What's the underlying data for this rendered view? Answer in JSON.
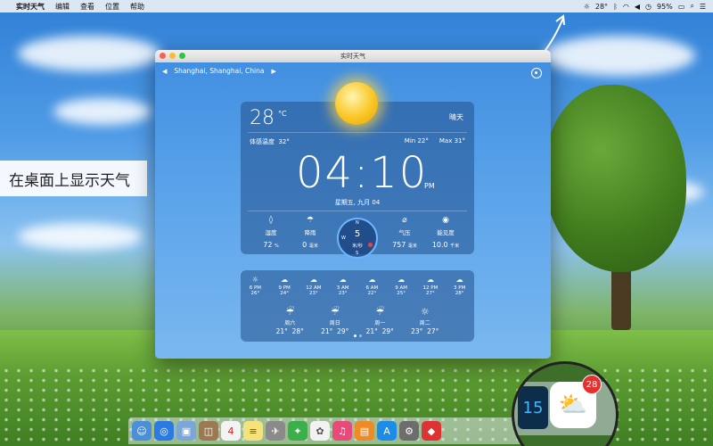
{
  "menubar": {
    "apple_icon": "apple-icon",
    "items": [
      "实时天气",
      "编辑",
      "查看",
      "位置",
      "帮助"
    ],
    "status": {
      "weather": "28°",
      "battery": "95%"
    }
  },
  "side_label": "在桌面上显示天气",
  "window": {
    "title": "实时天气",
    "location": "Shanghai, Shanghai, China",
    "current": {
      "temp": "28",
      "unit": "°C",
      "condition": "晴天",
      "feels_like_label": "体感温度",
      "feels_like": "32°",
      "min_label": "Min",
      "min": "22°",
      "max_label": "Max",
      "max": "31°",
      "time": "04:10",
      "ampm": "PM",
      "date": "星期五, 九月 04"
    },
    "stats": {
      "humidity": {
        "label": "湿度",
        "value": "72",
        "unit": "%"
      },
      "rain": {
        "label": "降雨",
        "value": "0",
        "unit": "毫米"
      },
      "wind": {
        "value": "5",
        "unit": "米/秒",
        "n": "N",
        "s": "S",
        "w": "W"
      },
      "pressure": {
        "label": "气压",
        "value": "757",
        "unit": "毫米"
      },
      "visibility": {
        "label": "能见度",
        "value": "10.0",
        "unit": "千米"
      }
    },
    "hourly": [
      {
        "time": "6 PM",
        "temp": "26°",
        "icon": "sun-icon"
      },
      {
        "time": "9 PM",
        "temp": "24°",
        "icon": "cloud-icon"
      },
      {
        "time": "12 AM",
        "temp": "23°",
        "icon": "cloud-icon"
      },
      {
        "time": "3 AM",
        "temp": "23°",
        "icon": "cloud-icon"
      },
      {
        "time": "6 AM",
        "temp": "22°",
        "icon": "cloud-icon"
      },
      {
        "time": "9 AM",
        "temp": "25°",
        "icon": "cloud-icon"
      },
      {
        "time": "12 PM",
        "temp": "27°",
        "icon": "cloud-icon"
      },
      {
        "time": "3 PM",
        "temp": "28°",
        "icon": "cloud-icon"
      }
    ],
    "daily": [
      {
        "name": "周六",
        "low": "21°",
        "high": "28°",
        "icon": "rain-icon"
      },
      {
        "name": "周日",
        "low": "21°",
        "high": "29°",
        "icon": "rain-icon"
      },
      {
        "name": "周一",
        "low": "21°",
        "high": "29°",
        "icon": "rain-icon"
      },
      {
        "name": "周二",
        "low": "23°",
        "high": "27°",
        "icon": "sun-icon"
      }
    ]
  },
  "magnifier": {
    "clock_digits": "15",
    "badge": "28"
  }
}
